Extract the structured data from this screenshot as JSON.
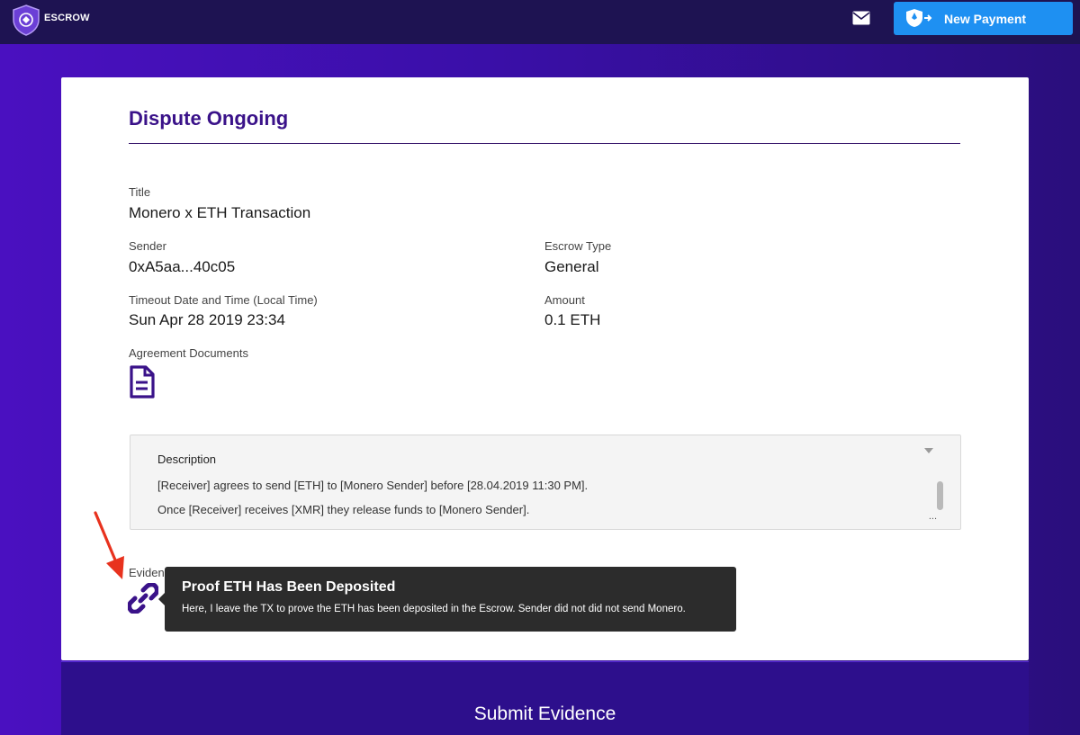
{
  "header": {
    "logo_text": "ESCROW",
    "new_payment_label": "New Payment"
  },
  "page": {
    "heading": "Dispute Ongoing"
  },
  "details": {
    "title_label": "Title",
    "title_value": "Monero x ETH Transaction",
    "sender_label": "Sender",
    "sender_value": "0xA5aa...40c05",
    "escrow_type_label": "Escrow Type",
    "escrow_type_value": "General",
    "timeout_label": "Timeout Date and Time (Local Time)",
    "timeout_value": "Sun Apr 28 2019 23:34",
    "amount_label": "Amount",
    "amount_value": "0.1 ETH",
    "documents_label": "Agreement Documents"
  },
  "description": {
    "title": "Description",
    "lines": [
      "[Receiver] agrees to send [ETH] to [Monero Sender] before [28.04.2019 11:30 PM].",
      "Once [Receiver] receives [XMR] they release funds to [Monero Sender]."
    ],
    "more": "..."
  },
  "evidence": {
    "label": "Evidence",
    "tooltip_title": "Proof ETH Has Been Deposited",
    "tooltip_body": "Here, I leave the TX to prove the ETH has been deposited in the Escrow. Sender did not did not send Monero."
  },
  "submit": {
    "label": "Submit Evidence"
  },
  "colors": {
    "accent": "#3a1289",
    "primary_button": "#1e90f2",
    "topbar": "#1e1352",
    "annotation_arrow": "#e8321e"
  }
}
